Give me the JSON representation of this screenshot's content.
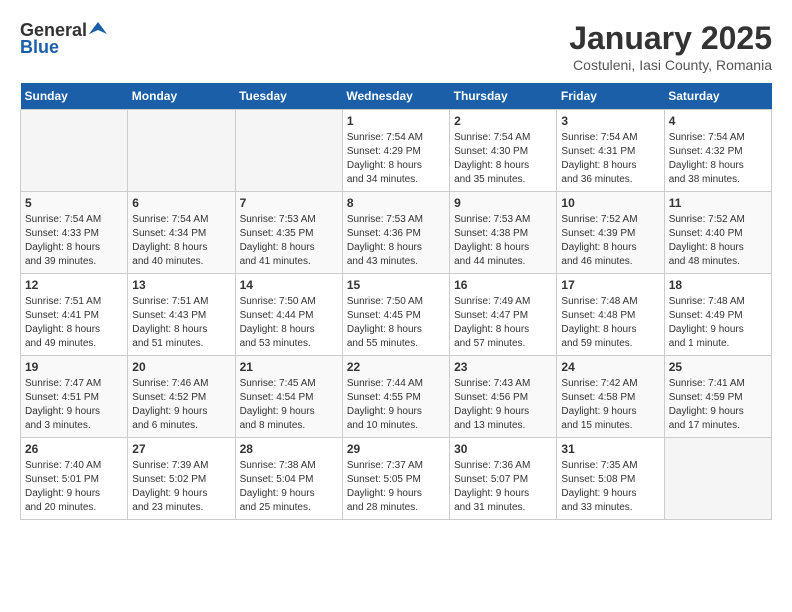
{
  "header": {
    "logo_general": "General",
    "logo_blue": "Blue",
    "title": "January 2025",
    "subtitle": "Costuleni, Iasi County, Romania"
  },
  "columns": [
    "Sunday",
    "Monday",
    "Tuesday",
    "Wednesday",
    "Thursday",
    "Friday",
    "Saturday"
  ],
  "weeks": [
    [
      {
        "day": "",
        "info": ""
      },
      {
        "day": "",
        "info": ""
      },
      {
        "day": "",
        "info": ""
      },
      {
        "day": "1",
        "info": "Sunrise: 7:54 AM\nSunset: 4:29 PM\nDaylight: 8 hours\nand 34 minutes."
      },
      {
        "day": "2",
        "info": "Sunrise: 7:54 AM\nSunset: 4:30 PM\nDaylight: 8 hours\nand 35 minutes."
      },
      {
        "day": "3",
        "info": "Sunrise: 7:54 AM\nSunset: 4:31 PM\nDaylight: 8 hours\nand 36 minutes."
      },
      {
        "day": "4",
        "info": "Sunrise: 7:54 AM\nSunset: 4:32 PM\nDaylight: 8 hours\nand 38 minutes."
      }
    ],
    [
      {
        "day": "5",
        "info": "Sunrise: 7:54 AM\nSunset: 4:33 PM\nDaylight: 8 hours\nand 39 minutes."
      },
      {
        "day": "6",
        "info": "Sunrise: 7:54 AM\nSunset: 4:34 PM\nDaylight: 8 hours\nand 40 minutes."
      },
      {
        "day": "7",
        "info": "Sunrise: 7:53 AM\nSunset: 4:35 PM\nDaylight: 8 hours\nand 41 minutes."
      },
      {
        "day": "8",
        "info": "Sunrise: 7:53 AM\nSunset: 4:36 PM\nDaylight: 8 hours\nand 43 minutes."
      },
      {
        "day": "9",
        "info": "Sunrise: 7:53 AM\nSunset: 4:38 PM\nDaylight: 8 hours\nand 44 minutes."
      },
      {
        "day": "10",
        "info": "Sunrise: 7:52 AM\nSunset: 4:39 PM\nDaylight: 8 hours\nand 46 minutes."
      },
      {
        "day": "11",
        "info": "Sunrise: 7:52 AM\nSunset: 4:40 PM\nDaylight: 8 hours\nand 48 minutes."
      }
    ],
    [
      {
        "day": "12",
        "info": "Sunrise: 7:51 AM\nSunset: 4:41 PM\nDaylight: 8 hours\nand 49 minutes."
      },
      {
        "day": "13",
        "info": "Sunrise: 7:51 AM\nSunset: 4:43 PM\nDaylight: 8 hours\nand 51 minutes."
      },
      {
        "day": "14",
        "info": "Sunrise: 7:50 AM\nSunset: 4:44 PM\nDaylight: 8 hours\nand 53 minutes."
      },
      {
        "day": "15",
        "info": "Sunrise: 7:50 AM\nSunset: 4:45 PM\nDaylight: 8 hours\nand 55 minutes."
      },
      {
        "day": "16",
        "info": "Sunrise: 7:49 AM\nSunset: 4:47 PM\nDaylight: 8 hours\nand 57 minutes."
      },
      {
        "day": "17",
        "info": "Sunrise: 7:48 AM\nSunset: 4:48 PM\nDaylight: 8 hours\nand 59 minutes."
      },
      {
        "day": "18",
        "info": "Sunrise: 7:48 AM\nSunset: 4:49 PM\nDaylight: 9 hours\nand 1 minute."
      }
    ],
    [
      {
        "day": "19",
        "info": "Sunrise: 7:47 AM\nSunset: 4:51 PM\nDaylight: 9 hours\nand 3 minutes."
      },
      {
        "day": "20",
        "info": "Sunrise: 7:46 AM\nSunset: 4:52 PM\nDaylight: 9 hours\nand 6 minutes."
      },
      {
        "day": "21",
        "info": "Sunrise: 7:45 AM\nSunset: 4:54 PM\nDaylight: 9 hours\nand 8 minutes."
      },
      {
        "day": "22",
        "info": "Sunrise: 7:44 AM\nSunset: 4:55 PM\nDaylight: 9 hours\nand 10 minutes."
      },
      {
        "day": "23",
        "info": "Sunrise: 7:43 AM\nSunset: 4:56 PM\nDaylight: 9 hours\nand 13 minutes."
      },
      {
        "day": "24",
        "info": "Sunrise: 7:42 AM\nSunset: 4:58 PM\nDaylight: 9 hours\nand 15 minutes."
      },
      {
        "day": "25",
        "info": "Sunrise: 7:41 AM\nSunset: 4:59 PM\nDaylight: 9 hours\nand 17 minutes."
      }
    ],
    [
      {
        "day": "26",
        "info": "Sunrise: 7:40 AM\nSunset: 5:01 PM\nDaylight: 9 hours\nand 20 minutes."
      },
      {
        "day": "27",
        "info": "Sunrise: 7:39 AM\nSunset: 5:02 PM\nDaylight: 9 hours\nand 23 minutes."
      },
      {
        "day": "28",
        "info": "Sunrise: 7:38 AM\nSunset: 5:04 PM\nDaylight: 9 hours\nand 25 minutes."
      },
      {
        "day": "29",
        "info": "Sunrise: 7:37 AM\nSunset: 5:05 PM\nDaylight: 9 hours\nand 28 minutes."
      },
      {
        "day": "30",
        "info": "Sunrise: 7:36 AM\nSunset: 5:07 PM\nDaylight: 9 hours\nand 31 minutes."
      },
      {
        "day": "31",
        "info": "Sunrise: 7:35 AM\nSunset: 5:08 PM\nDaylight: 9 hours\nand 33 minutes."
      },
      {
        "day": "",
        "info": ""
      }
    ]
  ]
}
